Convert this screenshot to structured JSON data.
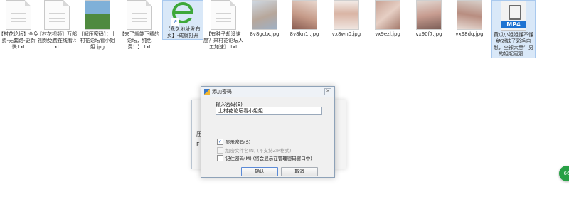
{
  "files": [
    {
      "caption": "【村花论坛】全免费-无套路-更新快.txt",
      "type": "doc"
    },
    {
      "caption": "【村花视频】万部视频免费在线看.txt",
      "type": "doc"
    },
    {
      "caption": "【解压密码】：上村花论坛看小姐姐.jpg",
      "type": "image"
    },
    {
      "caption": "【来了就能下载的论坛，纯色费！】.txt",
      "type": "doc"
    },
    {
      "caption": "【永久地址发布页】-成就打开",
      "type": "shortcut"
    },
    {
      "caption": "【有种子却没速度？来村花论坛人工加速】.txt",
      "type": "doc"
    },
    {
      "caption": "8v8gctx.jpg",
      "type": "photo"
    },
    {
      "caption": "8v8kn1i.jpg",
      "type": "photo"
    },
    {
      "caption": "vx8wn0.jpg",
      "type": "photo"
    },
    {
      "caption": "vx9ezl.jpg",
      "type": "photo"
    },
    {
      "caption": "vx90f7.jpg",
      "type": "photo"
    },
    {
      "caption": "vx98dq.jpg",
      "type": "photo"
    },
    {
      "caption": "黄瓜小姐姐懂不懂绝对妹子彩毛自慰，全裸大黑牛男的姐起冠股...",
      "type": "video",
      "badge": "MP4"
    }
  ],
  "behind_dialog": {
    "text_a": "压",
    "text_b": "F"
  },
  "dialog": {
    "title": "添加密码",
    "close_symbol": "✕",
    "password_label": "输入密码(E)",
    "password_value": "上村花论坛看小姐姐",
    "options": [
      {
        "label": "显示密码(S)",
        "checked": true,
        "enabled": true
      },
      {
        "label": "加密文件名(N) (不支持ZIP格式)",
        "checked": false,
        "enabled": false
      },
      {
        "label": "记住密码(M) (将会显示在管理密码窗口中)",
        "checked": false,
        "enabled": true
      }
    ],
    "ok_label": "确认",
    "cancel_label": "取消"
  },
  "float_badge": "66",
  "colors": {
    "accent": "#1e73d2",
    "badge_green": "#27a045"
  }
}
